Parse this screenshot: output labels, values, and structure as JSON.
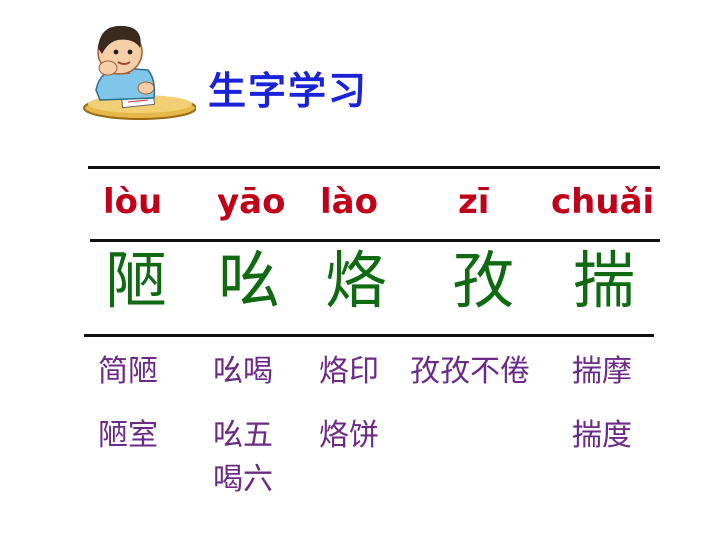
{
  "header": {
    "title": "生字学习"
  },
  "columns": [
    {
      "pinyin": "lòu",
      "char": "陋",
      "words": [
        "简陋",
        "陋室"
      ]
    },
    {
      "pinyin": "yāo",
      "char": "吆",
      "words": [
        "吆喝",
        "吆五",
        "喝六"
      ]
    },
    {
      "pinyin": "lào",
      "char": "烙",
      "words": [
        "烙印",
        "烙饼"
      ]
    },
    {
      "pinyin": "zī",
      "char": "孜",
      "words": [
        "孜孜不倦"
      ]
    },
    {
      "pinyin": "chuǎi",
      "char": "揣",
      "words": [
        "揣摩",
        "揣度"
      ]
    }
  ],
  "colors": {
    "title": "#1a23d6",
    "pinyin": "#c0001a",
    "hanzi": "#0f6a12",
    "words": "#6a2a86"
  }
}
